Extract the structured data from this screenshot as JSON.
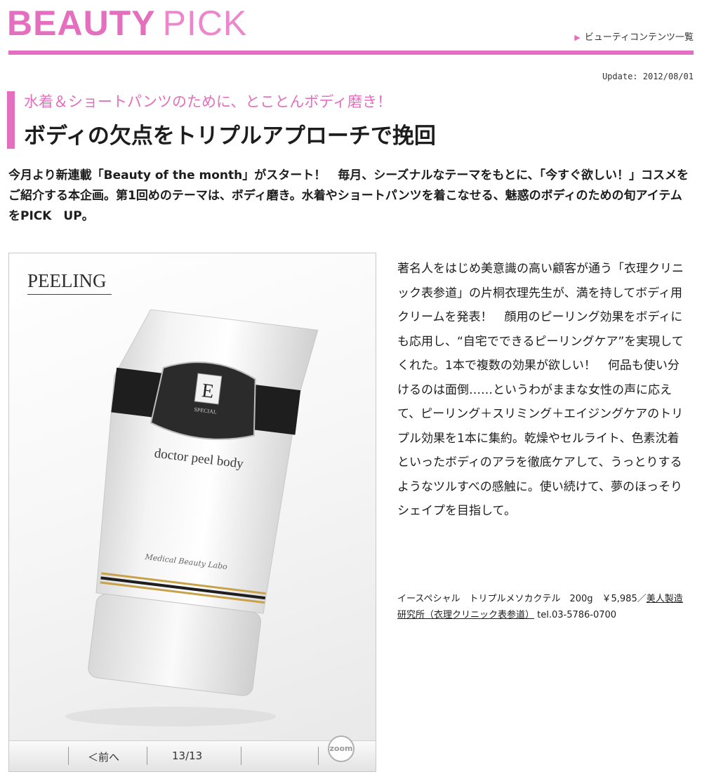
{
  "header": {
    "logo_bold": "BEAUTY",
    "logo_light": "PICK",
    "content_list_link": "ビューティコンテンツ一覧"
  },
  "update_text": "Update: 2012/08/01",
  "article": {
    "subhead": "水着＆ショートパンツのために、とことんボディ磨き！",
    "title": "ボディの欠点をトリプルアプローチで挽回",
    "lead": "今月より新連載「Beauty of the month」がスタート！　毎月、シーズナルなテーマをもとに、「今すぐ欲しい！」コスメをご紹介する本企画。第1回めのテーマは、ボディ磨き。水着やショートパンツを着こなせる、魅惑のボディのための旬アイテムをPICK　UP。",
    "body": "著名人をはじめ美意識の高い顧客が通う「衣理クリニック表参道」の片桐衣理先生が、満を持してボディ用クリームを発表！　顔用のピーリング効果をボディにも応用し、“自宅でできるピーリングケア”を実現してくれた。1本で複数の効果が欲しい！　何品も使い分けるのは面倒……というわがままな女性の声に応えて、ピーリング＋スリミング＋エイジングケアのトリプル効果を1本に集約。乾燥やセルライト、色素沈着といったボディのアラを徹底ケアして、うっとりするようなツルすべの感触に。使い続けて、夢のほっそりシェイプを目指して。",
    "product_name_price": "イースペシャル　トリプルメソカクテル　200g　￥5,985／",
    "product_maker": "美人製造研究所（衣理クリニック表参道）",
    "product_tel": " tel.03-5786-0700"
  },
  "gallery": {
    "image_label": "PEELING",
    "tube_brand_letter": "E",
    "tube_brand_word": "SPECIAL",
    "tube_product_text": "doctor peel body",
    "tube_script_text": "Medical Beauty Labo",
    "prev_label": "＜前へ",
    "counter": "13/13",
    "zoom_label": "zoom"
  },
  "colors": {
    "brand_pink": "#e46fbe",
    "text": "#1d1d1d"
  }
}
